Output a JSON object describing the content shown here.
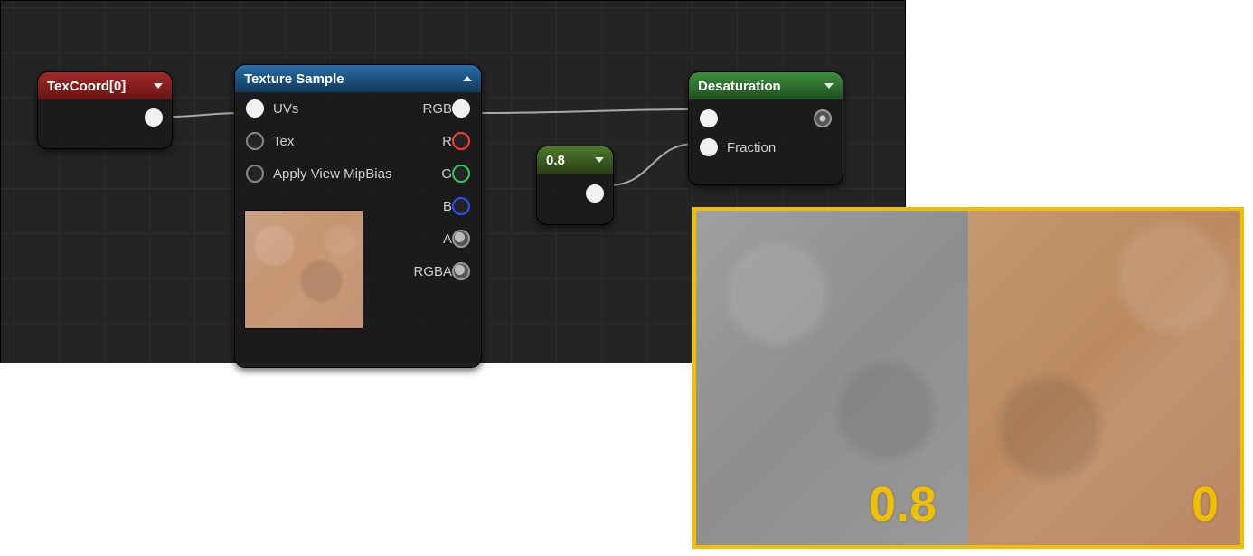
{
  "nodes": {
    "texcoord": {
      "title": "TexCoord[0]"
    },
    "textureSample": {
      "title": "Texture Sample",
      "inputs": {
        "uvs": "UVs",
        "tex": "Tex",
        "mipbias": "Apply View MipBias"
      },
      "outputs": {
        "rgb": "RGB",
        "r": "R",
        "g": "G",
        "b": "B",
        "a": "A",
        "rgba": "RGBA"
      }
    },
    "constant": {
      "title": "0.8"
    },
    "desaturation": {
      "title": "Desaturation",
      "inputs": {
        "fraction": "Fraction"
      }
    }
  },
  "overlay": {
    "leftLabel": "0.8",
    "rightLabel": "0"
  },
  "colors": {
    "accent": "#efbf00"
  }
}
